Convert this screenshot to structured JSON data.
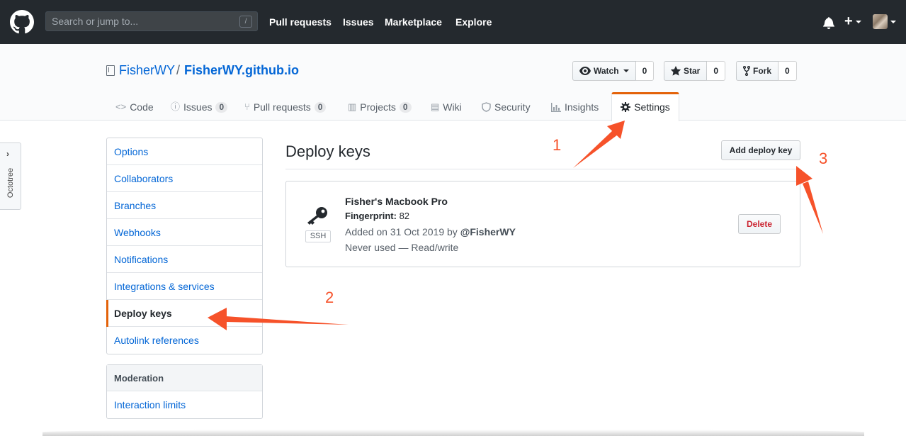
{
  "header": {
    "logo_icon": "github-octocat-icon",
    "search_placeholder": "Search or jump to...",
    "search_shortcut": "/",
    "nav": [
      "Pull requests",
      "Issues",
      "Marketplace",
      "Explore"
    ],
    "plus_label": "+"
  },
  "repo": {
    "owner": "FisherWY",
    "separator": "/",
    "name": "FisherWY.github.io",
    "watch_label": "Watch",
    "watch_count": "0",
    "star_label": "Star",
    "star_count": "0",
    "fork_label": "Fork",
    "fork_count": "0"
  },
  "tabs": [
    {
      "label": "Code",
      "icon": "code-icon"
    },
    {
      "label": "Issues",
      "icon": "issue-icon",
      "count": "0"
    },
    {
      "label": "Pull requests",
      "icon": "git-pull-request-icon",
      "count": "0"
    },
    {
      "label": "Projects",
      "icon": "project-icon",
      "count": "0"
    },
    {
      "label": "Wiki",
      "icon": "book-icon"
    },
    {
      "label": "Security",
      "icon": "shield-icon"
    },
    {
      "label": "Insights",
      "icon": "graph-icon"
    },
    {
      "label": "Settings",
      "icon": "gear-icon",
      "selected": true
    }
  ],
  "octotree": {
    "label": "Octotree"
  },
  "settings_menu": [
    "Options",
    "Collaborators",
    "Branches",
    "Webhooks",
    "Notifications",
    "Integrations & services",
    "Deploy keys",
    "Autolink references"
  ],
  "settings_menu_selected": "Deploy keys",
  "moderation": {
    "heading": "Moderation",
    "items": [
      "Interaction limits"
    ]
  },
  "main": {
    "title": "Deploy keys",
    "add_button": "Add deploy key",
    "key": {
      "title": "Fisher's Macbook Pro",
      "fingerprint_label": "Fingerprint:",
      "fingerprint_value": "82",
      "added_prefix": "Added on 31 Oct 2019 by ",
      "added_by": "@FisherWY",
      "usage": "Never used — Read/write",
      "type_badge": "SSH",
      "delete_button": "Delete"
    }
  },
  "annotations": [
    "1",
    "2",
    "3"
  ],
  "colors": {
    "header_bg": "#24292e",
    "link": "#0366d6",
    "accent_tab": "#e36209",
    "annotation": "#f6522a",
    "danger": "#cb2431"
  }
}
